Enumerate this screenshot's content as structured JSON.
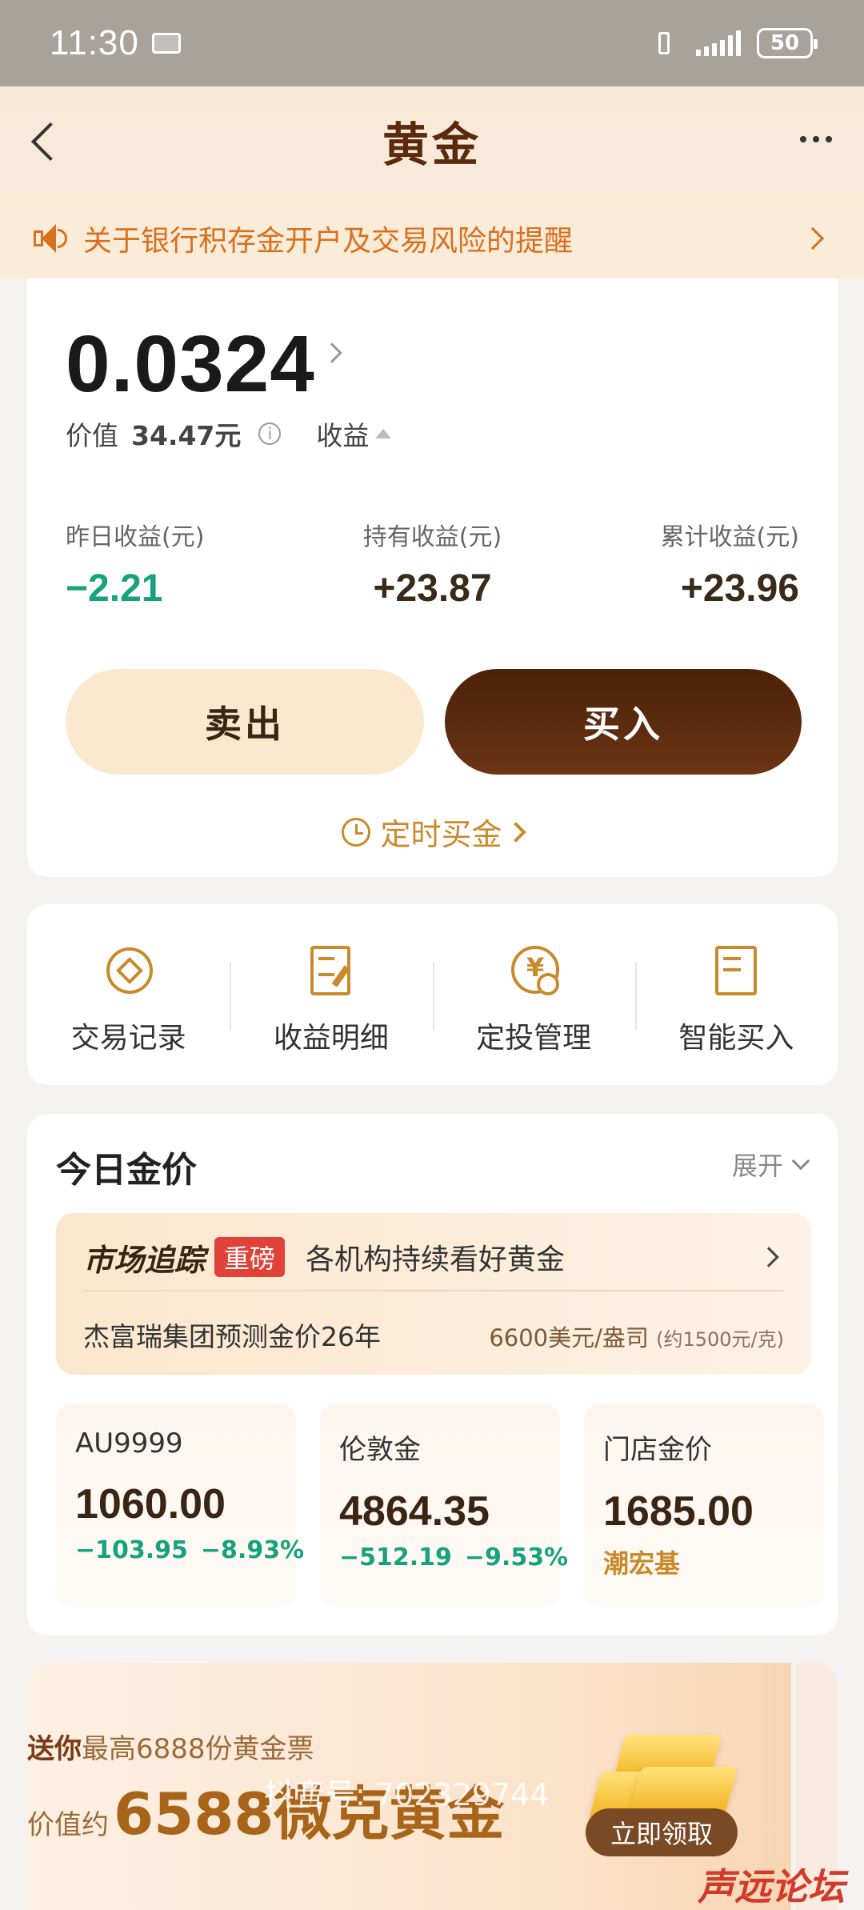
{
  "status_bar": {
    "time": "11:30",
    "battery": "50"
  },
  "nav": {
    "title": "黄金"
  },
  "notice": {
    "text": "关于银行积存金开户及交易风险的提醒"
  },
  "holding": {
    "amount": "0.0324",
    "value_label": "价值",
    "value": "34.47元",
    "income_label": "收益",
    "stats": [
      {
        "label": "昨日收益(元)",
        "value": "−2.21"
      },
      {
        "label": "持有收益(元)",
        "value": "+23.87"
      },
      {
        "label": "累计收益(元)",
        "value": "+23.96"
      }
    ],
    "sell_label": "卖出",
    "buy_label": "买入",
    "timed_label": "定时买金"
  },
  "actions": [
    {
      "label": "交易记录",
      "icon": "transaction-record-icon"
    },
    {
      "label": "收益明细",
      "icon": "income-detail-icon"
    },
    {
      "label": "定投管理",
      "icon": "auto-invest-icon"
    },
    {
      "label": "智能买入",
      "icon": "smart-buy-icon"
    }
  ],
  "gold_price": {
    "title": "今日金价",
    "expand_label": "展开",
    "market": {
      "logo": "市场追踪",
      "tag": "重磅",
      "headline": "各机构持续看好黄金",
      "forecast": "杰富瑞集团预测金价26年",
      "price": "6600美元/盎司",
      "price_note": "(约1500元/克)"
    },
    "tiles": [
      {
        "name": "AU9999",
        "price": "1060.00",
        "change": "−103.95",
        "change_pct": "−8.93%"
      },
      {
        "name": "伦敦金",
        "price": "4864.35",
        "change": "−512.19",
        "change_pct": "−9.53%"
      },
      {
        "name": "门店金价",
        "price": "1685.00",
        "brand": "潮宏基"
      }
    ]
  },
  "promo": {
    "line1_prefix": "送你",
    "line1_rest": "最高6888份黄金票",
    "line2_prefix": "价值约",
    "line2_big": "6588微克黄金",
    "claim_label": "立即领取"
  },
  "watermark": "抖音号: 702329744",
  "forum_logo": "声远论坛"
}
